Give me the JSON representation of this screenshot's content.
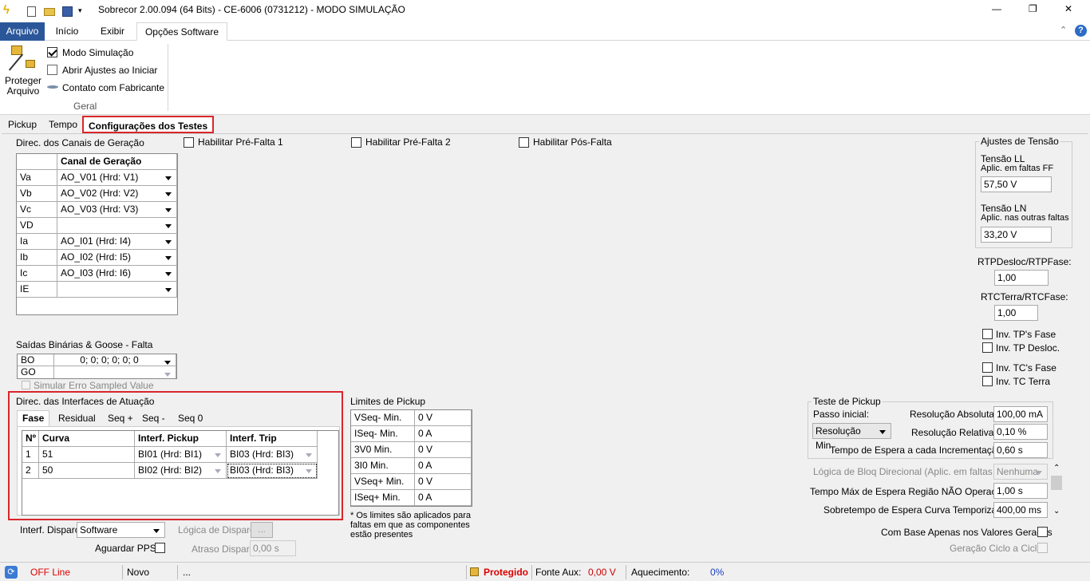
{
  "window": {
    "title": "Sobrecor 2.00.094 (64 Bits) - CE-6006 (0731212) - MODO SIMULAÇÃO",
    "minimize": "—",
    "restore": "❐",
    "close": "✕"
  },
  "ribbon_tabs": [
    "Arquivo",
    "Início",
    "Exibir",
    "Opções Software"
  ],
  "ribbon": {
    "protect_label": "Proteger\nArquivo",
    "modo_simulacao": "Modo Simulação",
    "abrir_ajustes": "Abrir Ajustes ao Iniciar",
    "contato": "Contato com Fabricante",
    "group": "Geral",
    "help": "?"
  },
  "page_tabs": [
    "Pickup",
    "Tempo",
    "Configurações dos Testes"
  ],
  "canais": {
    "title": "Direc. dos Canais de Geração",
    "header": "Canal de Geração",
    "rows": [
      [
        "Va",
        "AO_V01 (Hrd: V1)"
      ],
      [
        "Vb",
        "AO_V02 (Hrd: V2)"
      ],
      [
        "Vc",
        "AO_V03 (Hrd: V3)"
      ],
      [
        "VD",
        ""
      ],
      [
        "Ia",
        "AO_I01 (Hrd: I4)"
      ],
      [
        "Ib",
        "AO_I02 (Hrd: I5)"
      ],
      [
        "Ic",
        "AO_I03 (Hrd: I6)"
      ],
      [
        "IE",
        ""
      ]
    ]
  },
  "checks": {
    "pre1": "Habilitar Pré-Falta 1",
    "pre2": "Habilitar Pré-Falta 2",
    "pos": "Habilitar Pós-Falta"
  },
  "saidas": {
    "title": "Saídas Binárias & Goose - Falta",
    "bo_label": "BO",
    "bo_value": "0; 0; 0; 0; 0; 0",
    "go_label": "GO",
    "simular": "Simular Erro Sampled Value"
  },
  "interfaces": {
    "title": "Direc. das Interfaces de Atuação",
    "tabs": [
      "Fase",
      "Residual",
      "Seq +",
      "Seq -",
      "Seq 0"
    ],
    "headers": [
      "Nº",
      "Curva",
      "Interf. Pickup",
      "Interf. Trip"
    ],
    "rows": [
      [
        "1",
        "51",
        "BI01 (Hrd: BI1)",
        "BI03 (Hrd: BI3)"
      ],
      [
        "2",
        "50",
        "BI02 (Hrd: BI2)",
        "BI03 (Hrd: BI3)"
      ]
    ]
  },
  "interf_disparo": {
    "label": "Interf. Disparo",
    "value": "Software",
    "logica_label": "Lógica de Disparo",
    "logica_btn": "...",
    "pps_label": "Aguardar PPS",
    "atraso_label": "Atraso Disparo",
    "atraso_value": "0,00 s"
  },
  "limites": {
    "title": "Limites de Pickup",
    "rows": [
      [
        "VSeq- Min.",
        "0 V"
      ],
      [
        "ISeq- Min.",
        "0 A"
      ],
      [
        "3V0 Min.",
        "0 V"
      ],
      [
        "3I0 Min.",
        "0 A"
      ],
      [
        "VSeq+ Min.",
        "0 V"
      ],
      [
        "ISeq+ Min.",
        "0 A"
      ]
    ],
    "note": "* Os limites são aplicados para\nfaltas em que as componentes\nestão presentes"
  },
  "tensao": {
    "title": "Ajustes de Tensão",
    "ll_label": "Tensão LL",
    "ll_sub": "Aplic. em faltas FF",
    "ll_value": "57,50 V",
    "ln_label": "Tensão LN",
    "ln_sub": "Aplic. nas outras faltas",
    "ln_value": "33,20 V"
  },
  "rtp": {
    "label": "RTPDesloc/RTPFase:",
    "value": "1,00"
  },
  "rtc": {
    "label": "RTCTerra/RTCFase:",
    "value": "1,00"
  },
  "inv": [
    "Inv. TP's Fase",
    "Inv. TP Desloc.",
    "Inv. TC's Fase",
    "Inv. TC Terra"
  ],
  "teste": {
    "title": "Teste de Pickup",
    "passo_label": "Passo inicial:",
    "passo_value": "Resolução Min",
    "res_abs_label": "Resolução Absoluta:",
    "res_abs_value": "100,00 mA",
    "res_rel_label": "Resolução Relativa:",
    "res_rel_value": "0,10 %",
    "tempo_label": "Tempo de Espera a cada Incrementação:",
    "tempo_value": "0,60 s"
  },
  "bloq": {
    "label": "Lógica de Bloq Direcional (Aplic. em faltas FF):",
    "value": "Nenhuma"
  },
  "tempo_max": {
    "label": "Tempo Máx de Espera Região NÃO Operação:",
    "value": "1,00 s"
  },
  "sobretempo": {
    "label": "Sobretempo de Espera Curva Temporizada:",
    "value": "400,00 ms"
  },
  "com_base": "Com Base Apenas nos Valores Gerados",
  "geracao": "Geração Ciclo a Ciclo",
  "status": {
    "offline": "OFF Line",
    "novo": "Novo",
    "dots": "...",
    "protegido": "Protegido",
    "fonte_label": "Fonte Aux:",
    "fonte_value": "0,00 V",
    "aquec_label": "Aquecimento:",
    "aquec_value": "0%"
  }
}
